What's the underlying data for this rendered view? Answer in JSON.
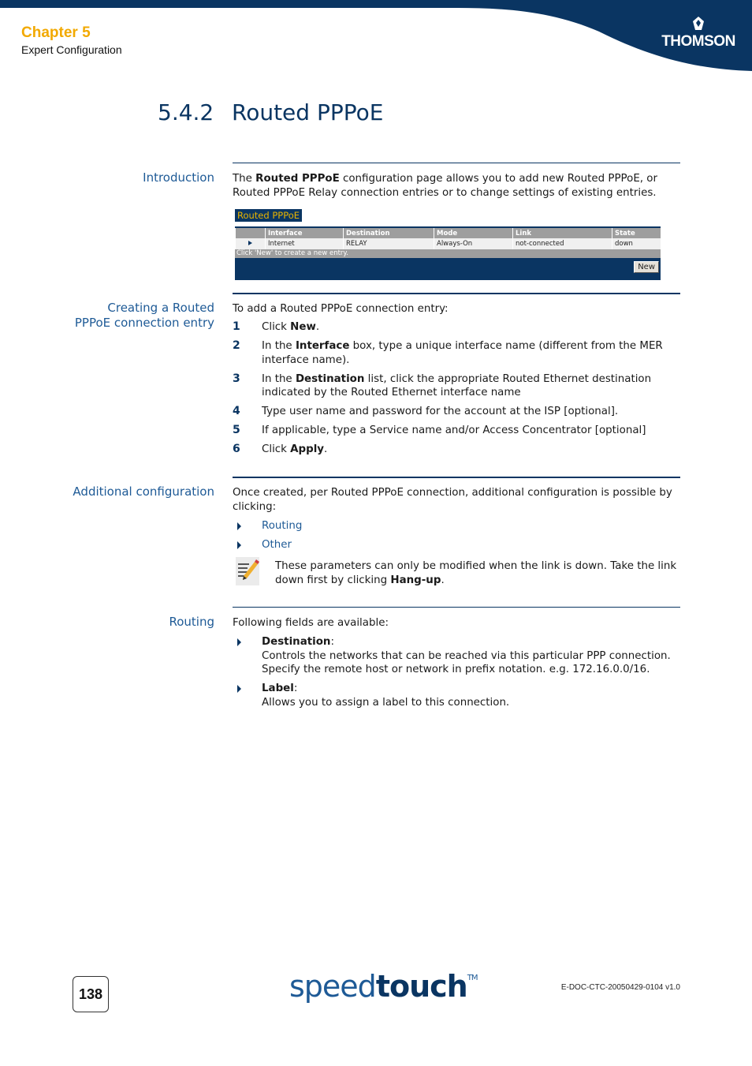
{
  "header": {
    "chapter": "Chapter 5",
    "chapter_subtitle": "Expert Configuration",
    "brand": "THOMSON",
    "brand_color": "#0a3562",
    "accent_color": "#f2a900"
  },
  "section": {
    "number": "5.4.2",
    "title": "Routed PPPoE"
  },
  "introduction": {
    "label": "Introduction",
    "text_prefix": "The ",
    "text_bold": "Routed PPPoE",
    "text_suffix": " configuration page allows you to add new Routed PPPoE, or Routed PPPoE Relay connection entries or to change settings of existing entries."
  },
  "widget": {
    "title": "Routed PPPoE",
    "columns": [
      "",
      "Interface",
      "Destination",
      "Mode",
      "Link",
      "State"
    ],
    "rows": [
      {
        "interface": "Internet",
        "destination": "RELAY",
        "mode": "Always-On",
        "link": "not-connected",
        "state": "down"
      }
    ],
    "hint": "Click 'New' to create a new entry.",
    "new_button": "New"
  },
  "creating": {
    "label_line1": "Creating a Routed",
    "label_line2": "PPPoE connection entry",
    "intro": "To add a Routed PPPoE connection entry:",
    "steps": [
      {
        "n": "1",
        "pre": "Click ",
        "bold": "New",
        "post": "."
      },
      {
        "n": "2",
        "pre": "In the ",
        "bold": "Interface",
        "post": " box, type a unique interface name (different from the MER interface name)."
      },
      {
        "n": "3",
        "pre": "In the ",
        "bold": "Destination",
        "post": " list, click the appropriate Routed Ethernet destination indicated by the Routed Ethernet interface name"
      },
      {
        "n": "4",
        "pre": "Type user name and password for the account at the ISP [optional].",
        "bold": "",
        "post": ""
      },
      {
        "n": "5",
        "pre": "If applicable, type a Service name and/or Access Concentrator [optional]",
        "bold": "",
        "post": ""
      },
      {
        "n": "6",
        "pre": "Click ",
        "bold": "Apply",
        "post": "."
      }
    ]
  },
  "additional": {
    "label": "Additional configuration",
    "intro": "Once created, per Routed PPPoE connection, additional configuration is possible by clicking:",
    "links": [
      "Routing",
      "Other"
    ],
    "note_pre": "These parameters can only be modified when the link is down. Take the link down first by clicking ",
    "note_bold": "Hang-up",
    "note_post": "."
  },
  "routing": {
    "label": "Routing",
    "intro": "Following fields are available:",
    "fields": [
      {
        "name": "Destination",
        "desc": "Controls the networks that can be reached via this particular PPP connection. Specify the remote host or network in prefix notation. e.g. 172.16.0.0/16."
      },
      {
        "name": "Label",
        "desc": "Allows you to assign a label to this connection."
      }
    ]
  },
  "footer": {
    "page_number": "138",
    "logo_light": "speed",
    "logo_bold": "touch",
    "logo_tm": "TM",
    "doc_id": "E-DOC-CTC-20050429-0104 v1.0"
  }
}
